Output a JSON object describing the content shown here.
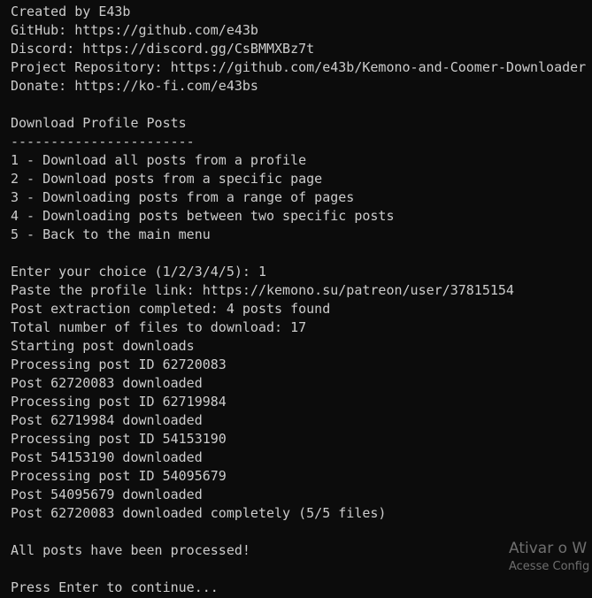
{
  "terminal": {
    "lines": [
      "Created by E43b",
      "GitHub: https://github.com/e43b",
      "Discord: https://discord.gg/CsBMMXBz7t",
      "Project Repository: https://github.com/e43b/Kemono-and-Coomer-Downloader",
      "Donate: https://ko-fi.com/e43bs",
      "",
      "Download Profile Posts",
      "-----------------------",
      "1 - Download all posts from a profile",
      "2 - Download posts from a specific page",
      "3 - Downloading posts from a range of pages",
      "4 - Downloading posts between two specific posts",
      "5 - Back to the main menu",
      "",
      "Enter your choice (1/2/3/4/5): 1",
      "Paste the profile link: https://kemono.su/patreon/user/37815154",
      "Post extraction completed: 4 posts found",
      "Total number of files to download: 17",
      "Starting post downloads",
      "Processing post ID 62720083",
      "Post 62720083 downloaded",
      "Processing post ID 62719984",
      "Post 62719984 downloaded",
      "Processing post ID 54153190",
      "Post 54153190 downloaded",
      "Processing post ID 54095679",
      "Post 54095679 downloaded",
      "Post 62720083 downloaded completely (5/5 files)",
      "",
      "All posts have been processed!",
      "",
      "Press Enter to continue..."
    ]
  },
  "watermark": {
    "title": "Ativar o W",
    "subtitle": "Acesse Config"
  },
  "colors": {
    "background": "#0c0c0c",
    "text": "#cccccc",
    "watermark": "#6f6f6f"
  }
}
